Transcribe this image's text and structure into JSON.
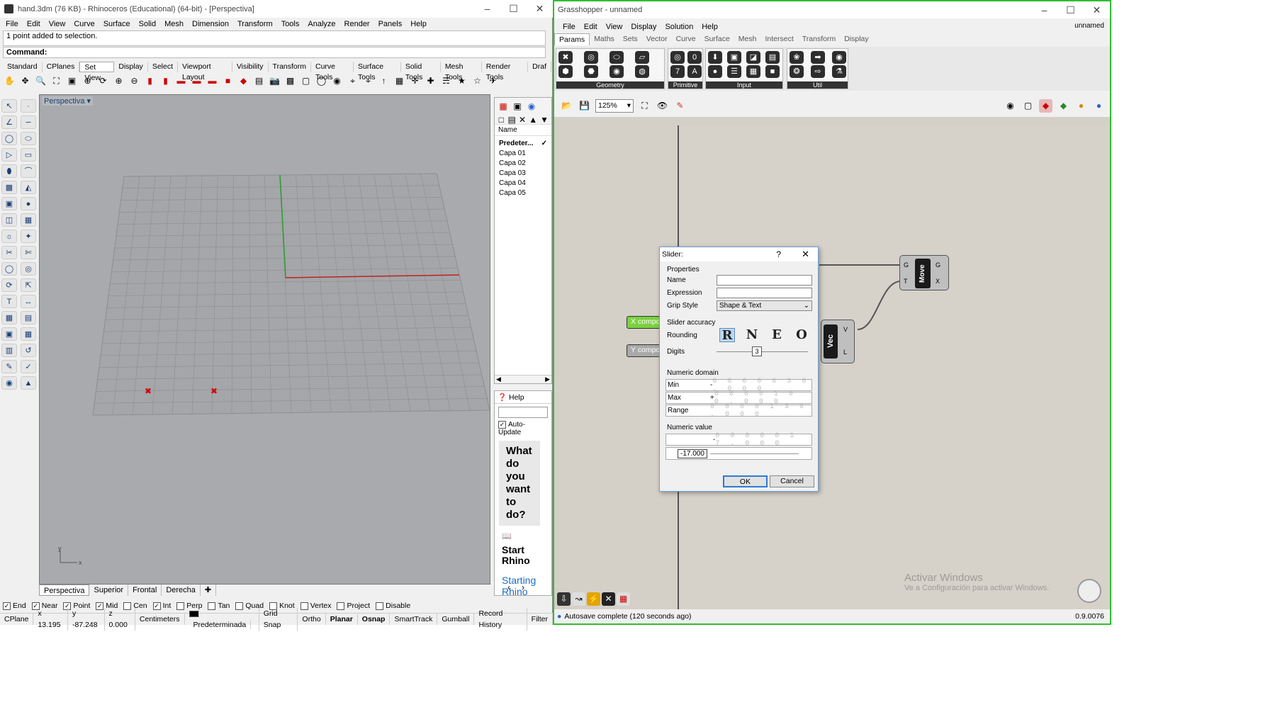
{
  "rhino": {
    "title": "hand.3dm (76 KB) - Rhinoceros (Educational) (64-bit) - [Perspectiva]",
    "menu": [
      "File",
      "Edit",
      "View",
      "Curve",
      "Surface",
      "Solid",
      "Mesh",
      "Dimension",
      "Transform",
      "Tools",
      "Analyze",
      "Render",
      "Panels",
      "Help"
    ],
    "command_history": "1 point added to selection.",
    "command_label": "Command:",
    "toolbar_tabs": [
      "Standard",
      "CPlanes",
      "Set View",
      "Display",
      "Select",
      "Viewport Layout",
      "Visibility",
      "Transform",
      "Curve Tools",
      "Surface Tools",
      "Solid Tools",
      "Mesh Tools",
      "Render Tools",
      "Draf"
    ],
    "active_tab": "Set View",
    "viewport_label": "Perspectiva",
    "viewport_tabs": [
      "Perspectiva",
      "Superior",
      "Frontal",
      "Derecha"
    ],
    "osnaps": [
      {
        "label": "End",
        "on": true
      },
      {
        "label": "Near",
        "on": true
      },
      {
        "label": "Point",
        "on": true
      },
      {
        "label": "Mid",
        "on": true
      },
      {
        "label": "Cen",
        "on": false
      },
      {
        "label": "Int",
        "on": true
      },
      {
        "label": "Perp",
        "on": false
      },
      {
        "label": "Tan",
        "on": false
      },
      {
        "label": "Quad",
        "on": false
      },
      {
        "label": "Knot",
        "on": false
      },
      {
        "label": "Vertex",
        "on": false
      },
      {
        "label": "Project",
        "on": false
      },
      {
        "label": "Disable",
        "on": false
      }
    ],
    "status": {
      "cplane": "CPlane",
      "x": "x 13.195",
      "y": "y -87.248",
      "z": "z 0.000",
      "units": "Centimeters",
      "layer": "Predeterminada",
      "items": [
        "Grid Snap",
        "Ortho",
        "Planar",
        "Osnap",
        "SmartTrack",
        "Gumball",
        "Record History",
        "Filter"
      ]
    },
    "layers": {
      "col_name": "Name",
      "items": [
        "Predeter...",
        "Capa 01",
        "Capa 02",
        "Capa 03",
        "Capa 04",
        "Capa 05"
      ]
    },
    "help": {
      "tab": "Help",
      "auto_update": "Auto-Update",
      "question": "What do you want to do?",
      "start": "Start Rhino",
      "link": "Starting Rhino with shortcut"
    },
    "axis_labels": {
      "x": "x",
      "y": "y"
    }
  },
  "gh": {
    "title": "Grasshopper - unnamed",
    "doc_name": "unnamed",
    "menu": [
      "File",
      "Edit",
      "View",
      "Display",
      "Solution",
      "Help"
    ],
    "tabs": [
      "Params",
      "Maths",
      "Sets",
      "Vector",
      "Curve",
      "Surface",
      "Mesh",
      "Intersect",
      "Transform",
      "Display"
    ],
    "groups": [
      "Geometry",
      "Primitive",
      "Input",
      "Util"
    ],
    "zoom": "125%",
    "status": "Autosave complete (120 seconds ago)",
    "version": "0.9.0076",
    "watermark_title": "Activar Windows",
    "watermark_sub": "Ve a Configuración para activar Windows.",
    "components": {
      "move": "Move",
      "move_g_in": "G",
      "move_t_in": "T",
      "move_g_out": "G",
      "move_x_out": "X",
      "vec": "Vec",
      "vec_v": "V",
      "vec_l": "L",
      "x_slider": "X compo",
      "y_slider": "Y compo"
    }
  },
  "dialog": {
    "title": "Slider:",
    "help": "?",
    "properties": "Properties",
    "name_label": "Name",
    "name_value": "",
    "expression_label": "Expression",
    "expression_value": "",
    "grip_label": "Grip Style",
    "grip_value": "Shape & Text",
    "accuracy": "Slider accuracy",
    "rounding_label": "Rounding",
    "rounding_opts": [
      "R",
      "N",
      "E",
      "O"
    ],
    "digits_label": "Digits",
    "digits_value": "3",
    "domain": "Numeric domain",
    "min_label": "Min",
    "min_sign": "-",
    "min_value": "0 0 0 0 0 3 0 . 0 0 0",
    "max_label": "Max",
    "max_sign": "+",
    "max_value": "0 0 0 0 1 0 0 . 0 0 0",
    "range_label": "Range",
    "range_value": "0 0 0 0 1 3 0 . 0 0 0",
    "value_section": "Numeric value",
    "value_sign": "-",
    "value_digits": "0 0 0 0 0 1 7 . 0 0 0",
    "value_text": "-17.000",
    "ok": "OK",
    "cancel": "Cancel"
  }
}
